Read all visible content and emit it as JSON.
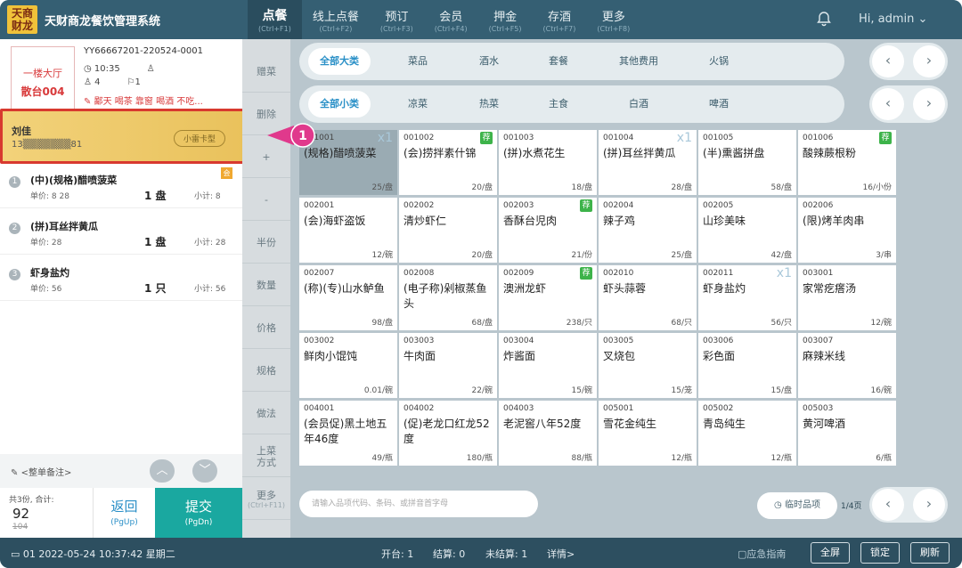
{
  "app": {
    "title": "天财商龙餐饮管理系统",
    "logo_text": [
      "天商",
      "财龙"
    ]
  },
  "nav": {
    "tabs": [
      {
        "label": "点餐",
        "key": "(Ctrl+F1)",
        "active": true
      },
      {
        "label": "线上点餐",
        "key": "(Ctrl+F2)"
      },
      {
        "label": "预订",
        "key": "(Ctrl+F3)"
      },
      {
        "label": "会员",
        "key": "(Ctrl+F4)"
      },
      {
        "label": "押金",
        "key": "(Ctrl+F5)"
      },
      {
        "label": "存酒",
        "key": "(Ctrl+F7)"
      },
      {
        "label": "更多",
        "key": "(Ctrl+F8)"
      }
    ],
    "user": "Hi, admin"
  },
  "order": {
    "area": "一楼大厅",
    "table": "散台004",
    "order_no": "YY66667201-220524-0001",
    "time": "10:35",
    "guests": "4",
    "waiter": "",
    "seats": "1",
    "remark": "鄙天 喝茶 靠窗 喝酒 不吃..."
  },
  "member": {
    "name": "刘佳",
    "phone": "13▒▒▒▒▒▒▒81",
    "card": "小雷卡型"
  },
  "items": [
    {
      "num": "1",
      "name": "(中)(规格)醋喷菠菜",
      "price_label": "单价: 8 28",
      "qty": "1 盘",
      "subtotal": "小计: 8",
      "tag": "会"
    },
    {
      "num": "2",
      "name": "(拼)耳丝拌黄瓜",
      "price_label": "单价: 28",
      "qty": "1 盘",
      "subtotal": "小计: 28"
    },
    {
      "num": "3",
      "name": "虾身盐灼",
      "price_label": "单价: 56",
      "qty": "1 只",
      "subtotal": "小计: 56"
    }
  ],
  "note_placeholder": "<整单备注>",
  "totals": {
    "count_label": "共3份, 合计:",
    "total": "92",
    "original": "104"
  },
  "buttons": {
    "back": {
      "label": "返回",
      "key": "(PgUp)"
    },
    "submit": {
      "label": "提交",
      "key": "(PgDn)"
    }
  },
  "ops": [
    {
      "label": "赠菜"
    },
    {
      "label": "删除"
    },
    {
      "label": "+"
    },
    {
      "label": "-"
    },
    {
      "label": "半份"
    },
    {
      "label": "数量"
    },
    {
      "label": "价格"
    },
    {
      "label": "规格"
    },
    {
      "label": "做法"
    },
    {
      "label": "上菜方式"
    },
    {
      "label": "更多",
      "key": "(Ctrl+F11)"
    }
  ],
  "categories_big": [
    "全部大类",
    "菜品",
    "酒水",
    "套餐",
    "其他费用",
    "火锅"
  ],
  "categories_small": [
    "全部小类",
    "凉菜",
    "热菜",
    "主食",
    "白酒",
    "啤酒"
  ],
  "dishes": [
    {
      "code": "001001",
      "name": "(规格)醋喷菠菜",
      "price": "25/盘",
      "mark": "x1",
      "selected": true
    },
    {
      "code": "001002",
      "name": "(会)捞拌素什锦",
      "price": "20/盘",
      "mark": "荐"
    },
    {
      "code": "001003",
      "name": "(拼)水煮花生",
      "price": "18/盘"
    },
    {
      "code": "001004",
      "name": "(拼)耳丝拌黄瓜",
      "price": "28/盘",
      "mark": "x1"
    },
    {
      "code": "001005",
      "name": "(半)熏酱拼盘",
      "price": "58/盘"
    },
    {
      "code": "001006",
      "name": "酸辣蕨根粉",
      "price": "16/小份",
      "mark": "荐"
    },
    {
      "code": "002001",
      "name": "(会)海虾盗饭",
      "price": "12/碗"
    },
    {
      "code": "002002",
      "name": "清炒虾仁",
      "price": "20/盘"
    },
    {
      "code": "002003",
      "name": "香酥台児肉",
      "price": "21/份",
      "mark": "荐"
    },
    {
      "code": "002004",
      "name": "辣子鸡",
      "price": "25/盘"
    },
    {
      "code": "002005",
      "name": "山珍美味",
      "price": "42/盘"
    },
    {
      "code": "002006",
      "name": "(限)烤羊肉串",
      "price": "3/串"
    },
    {
      "code": "002007",
      "name": "(称)(专)山水鲈鱼",
      "price": "98/盘"
    },
    {
      "code": "002008",
      "name": "(电子称)剁椒蒸鱼头",
      "price": "68/盘"
    },
    {
      "code": "002009",
      "name": "澳洲龙虾",
      "price": "238/只",
      "mark": "荐"
    },
    {
      "code": "002010",
      "name": "虾头蒜蓉",
      "price": "68/只"
    },
    {
      "code": "002011",
      "name": "虾身盐灼",
      "price": "56/只",
      "mark": "x1"
    },
    {
      "code": "003001",
      "name": "家常疙瘩汤",
      "price": "12/碗"
    },
    {
      "code": "003002",
      "name": "鲜肉小馄饨",
      "price": "0.01/碗"
    },
    {
      "code": "003003",
      "name": "牛肉面",
      "price": "22/碗"
    },
    {
      "code": "003004",
      "name": "炸酱面",
      "price": "15/碗"
    },
    {
      "code": "003005",
      "name": "叉烧包",
      "price": "15/笼"
    },
    {
      "code": "003006",
      "name": "彩色面",
      "price": "15/盘"
    },
    {
      "code": "003007",
      "name": "麻辣米线",
      "price": "16/碗"
    },
    {
      "code": "004001",
      "name": "(会员促)黑土地五年46度",
      "price": "49/瓶"
    },
    {
      "code": "004002",
      "name": "(促)老龙口红龙52度",
      "price": "180/瓶"
    },
    {
      "code": "004003",
      "name": "老泥窖八年52度",
      "price": "88/瓶"
    },
    {
      "code": "005001",
      "name": "雪花金纯生",
      "price": "12/瓶"
    },
    {
      "code": "005002",
      "name": "青岛纯生",
      "price": "12/瓶"
    },
    {
      "code": "005003",
      "name": "黄河啤酒",
      "price": "6/瓶"
    }
  ],
  "search": {
    "placeholder": "请输入品项代码、条码、或拼音首字母"
  },
  "temp_item": "临时品项",
  "page_info": "1/4页",
  "status": {
    "terminal": "01  2022-05-24 10:37:42 星期二",
    "open": "开台: 1",
    "settled": "结算: 0",
    "unsettled": "未结算: 1",
    "detail": "详情>",
    "guide": "应急指南",
    "buttons": [
      "全屏",
      "锁定",
      "刷新"
    ]
  },
  "callout_number": "1",
  "colors": {
    "accent": "#1aa8a0",
    "topbar": "#355f73",
    "alert": "#d8392f",
    "callout": "#e0398c"
  }
}
